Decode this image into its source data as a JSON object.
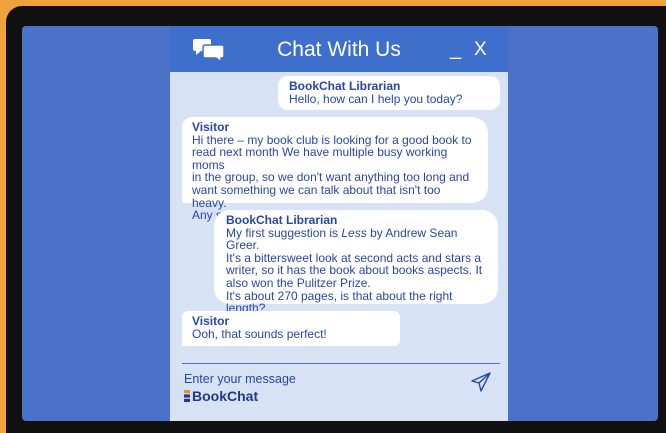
{
  "chat": {
    "title": "Chat With Us",
    "minimize_label": "_",
    "close_label": "X",
    "messages": [
      {
        "sender": "BookChat Librarian",
        "text": "Hello, how can I help you today?"
      },
      {
        "sender": "Visitor",
        "text": "Hi there – my book club is looking for a good book to\nread next month We have multiple busy working moms\nin the group, so we don't want anything too long and\nwant something we can talk about that isn't too heavy.\nAny suggestions?"
      },
      {
        "sender": "BookChat Librarian",
        "text_pre": "My first suggestion is ",
        "text_em": "Less",
        "text_post": " by Andrew Sean Greer.\nIt's a bittersweet look at second acts and stars a\nwriter, so it has the book about books aspects. It\nalso won the Pulitzer Prize.\nIt's about 270 pages, is that about the right length?"
      },
      {
        "sender": "Visitor",
        "text": "Ooh, that sounds perfect!"
      }
    ],
    "input_placeholder": "Enter your message",
    "brand": "BookChat"
  },
  "colors": {
    "frame_orange": "#f0a23c",
    "bezel": "#111111",
    "screen_blue": "#4a72c8",
    "header_blue": "#3f6fcd",
    "chat_bg": "#d7e2f5",
    "text_blue": "#2747a8",
    "brand_orange": "#f08a2c"
  },
  "icons": {
    "header": "chat-bubbles-icon",
    "send": "paper-plane-icon",
    "brand": "book-stack-icon"
  }
}
